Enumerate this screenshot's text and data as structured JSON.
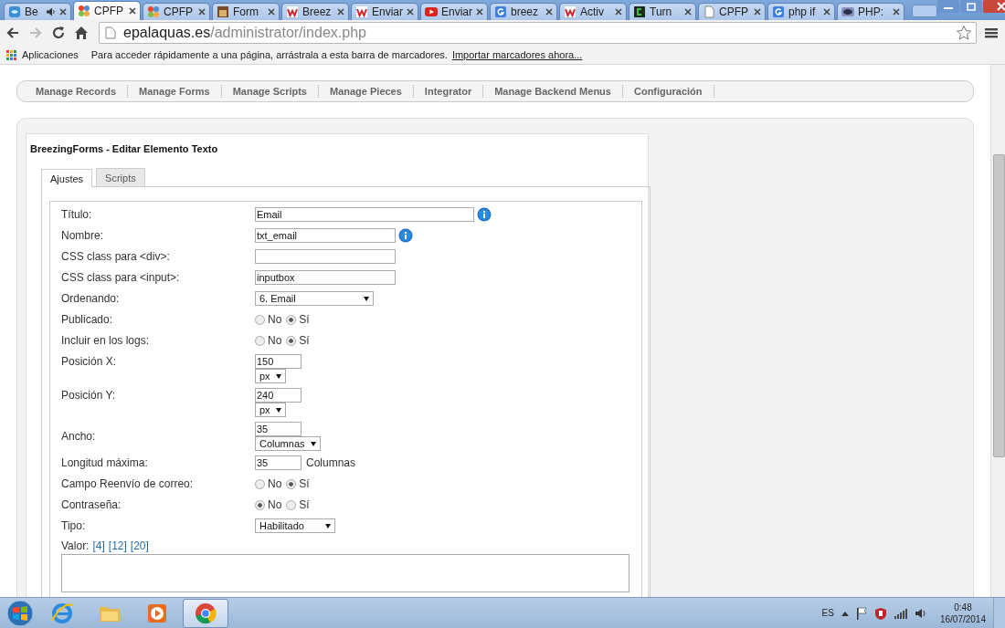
{
  "browser": {
    "tabs": [
      {
        "title": "Be",
        "kind": "globe",
        "audio": true,
        "selected": false
      },
      {
        "title": "CPFP",
        "kind": "flower",
        "audio": false,
        "selected": true
      },
      {
        "title": "CPFP",
        "kind": "flower",
        "audio": false,
        "selected": false
      },
      {
        "title": "Form",
        "kind": "image",
        "audio": false,
        "selected": false
      },
      {
        "title": "Breez",
        "kind": "wave",
        "audio": false,
        "selected": false
      },
      {
        "title": "Enviar",
        "kind": "wave",
        "audio": false,
        "selected": false
      },
      {
        "title": "Enviar",
        "kind": "video",
        "audio": false,
        "selected": false
      },
      {
        "title": "breez",
        "kind": "search",
        "audio": false,
        "selected": false
      },
      {
        "title": "Activ",
        "kind": "wave",
        "audio": false,
        "selected": false
      },
      {
        "title": "Turn",
        "kind": "terminal",
        "audio": false,
        "selected": false
      },
      {
        "title": "CPFP",
        "kind": "page",
        "audio": false,
        "selected": false
      },
      {
        "title": "php if",
        "kind": "search",
        "audio": false,
        "selected": false
      },
      {
        "title": "PHP:",
        "kind": "oval",
        "audio": false,
        "selected": false
      }
    ],
    "address": {
      "domain": "epalaquas.es",
      "path": "/administrator/index.php"
    },
    "bookmarks_bar": {
      "apps_label": "Aplicaciones",
      "hint": "Para acceder rápidamente a una página, arrástrala a esta barra de marcadores.",
      "import_link": "Importar marcadores ahora..."
    }
  },
  "menu": [
    "Manage Records",
    "Manage Forms",
    "Manage Scripts",
    "Manage Pieces",
    "Integrator",
    "Manage Backend Menus",
    "Configuración"
  ],
  "panel": {
    "title": "BreezingForms - Editar Elemento Texto",
    "tabs": [
      {
        "label": "Ajustes",
        "selected": true
      },
      {
        "label": "Scripts",
        "selected": false
      }
    ],
    "fields": [
      {
        "kind": "text",
        "label": "Título:",
        "value": "Email",
        "info": true
      },
      {
        "kind": "text",
        "label": "Nombre:",
        "value": "txt_email",
        "info": true
      },
      {
        "kind": "text",
        "label": "CSS class para <div>:",
        "info": false
      },
      {
        "kind": "text",
        "label": "CSS class para <input>:",
        "value": "inputbox",
        "info": false
      },
      {
        "kind": "select",
        "label": "Ordenando:",
        "value": "6. Email"
      },
      {
        "kind": "radio",
        "label": "Publicado:",
        "options": [
          {
            "label": "No",
            "selected": false
          },
          {
            "label": "Sí",
            "selected": true
          }
        ]
      },
      {
        "kind": "radio",
        "label": "Incluir en los logs:",
        "options": [
          {
            "label": "No",
            "selected": false
          },
          {
            "label": "Sí",
            "selected": true
          }
        ]
      },
      {
        "kind": "unit",
        "label": "Posición X:",
        "value": "150",
        "unit": "px"
      },
      {
        "kind": "unit",
        "label": "Posición Y:",
        "value": "240",
        "unit": "px"
      },
      {
        "kind": "unit",
        "label": "Ancho:",
        "value": "35",
        "unit": "Columnas"
      },
      {
        "kind": "suffix",
        "label": "Longitud máxima:",
        "value": "35",
        "suffix": "Columnas"
      },
      {
        "kind": "radio",
        "label": "Campo Reenvío de correo:",
        "options": [
          {
            "label": "No",
            "selected": false
          },
          {
            "label": "Sí",
            "selected": true
          }
        ]
      },
      {
        "kind": "radio",
        "label": "Contraseña:",
        "options": [
          {
            "label": "No",
            "selected": true
          },
          {
            "label": "Sí",
            "selected": false
          }
        ]
      },
      {
        "kind": "select",
        "label": "Tipo:",
        "value": "Habilitado"
      }
    ],
    "value_field": {
      "label": "Valor:",
      "links": [
        "[4]",
        "[12]",
        "[20]"
      ]
    }
  },
  "taskbar": {
    "apps": [
      {
        "kind": "ie",
        "selected": false
      },
      {
        "kind": "folder",
        "selected": false
      },
      {
        "kind": "media",
        "selected": false
      },
      {
        "kind": "chrome",
        "selected": true
      }
    ],
    "language": "ES",
    "time": "0:48",
    "date": "16/07/2014"
  }
}
